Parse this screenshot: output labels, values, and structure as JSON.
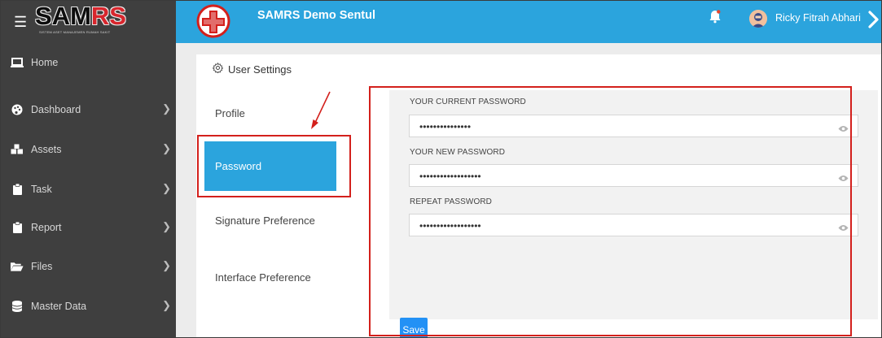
{
  "brand": {
    "logo_text_a": "SAM",
    "logo_text_b": "RS",
    "logo_tagline": "SISTEM ASET MANAJEMEN RUMAH SAKIT"
  },
  "sidebar": {
    "items": [
      {
        "label": "Home",
        "icon": "laptop-icon",
        "has_children": false
      },
      {
        "label": "Dashboard",
        "icon": "palette-icon",
        "has_children": true
      },
      {
        "label": "Assets",
        "icon": "cubes-icon",
        "has_children": true
      },
      {
        "label": "Task",
        "icon": "clipboard-icon",
        "has_children": true
      },
      {
        "label": "Report",
        "icon": "clipboard-icon",
        "has_children": true
      },
      {
        "label": "Files",
        "icon": "folder-open-icon",
        "has_children": true
      },
      {
        "label": "Master Data",
        "icon": "database-icon",
        "has_children": true
      }
    ]
  },
  "header": {
    "title": "SAMRS Demo Sentul",
    "user_name": "Ricky Fitrah Abhari",
    "accent": "#2ba4dd"
  },
  "settings": {
    "title": "User Settings",
    "menu": [
      {
        "label": "Profile",
        "active": false
      },
      {
        "label": "Password",
        "active": true
      },
      {
        "label": "Signature Preference",
        "active": false
      },
      {
        "label": "Interface Preference",
        "active": false
      }
    ]
  },
  "password_form": {
    "current_label": "YOUR CURRENT PASSWORD",
    "current_value": "•••••••••••••••",
    "new_label": "YOUR NEW PASSWORD",
    "new_value": "••••••••••••••••••",
    "repeat_label": "REPEAT PASSWORD",
    "repeat_value": "••••••••••••••••••",
    "save_label": "Save"
  },
  "colors": {
    "sidebar_bg": "#3f3f3f",
    "active": "#2ba4dd",
    "button": "#2391f5",
    "annotation": "#d3201c"
  }
}
